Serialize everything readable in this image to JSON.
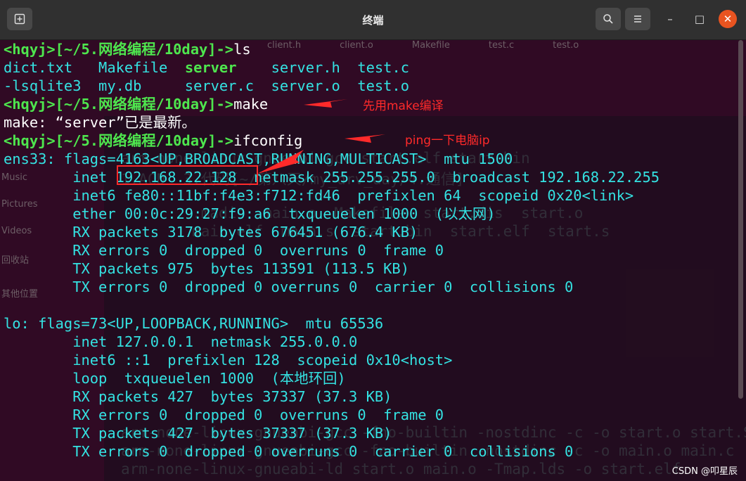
{
  "window": {
    "title": "终端",
    "new_tab_icon": "new-tab-icon",
    "search_icon": "search-icon",
    "menu_icon": "hamburger-menu-icon",
    "minimize": "–",
    "maximize": "□",
    "close": "✕"
  },
  "ghost": {
    "files": [
      "client.h",
      "client.o",
      "Makefile",
      "test.c",
      "test.o"
    ],
    "sidebar": [
      "Music",
      "Pictures",
      "Videos",
      "回收站",
      "其他位置"
    ]
  },
  "terminal": {
    "lines": [
      [
        {
          "t": "<hqyj>[~/5.网络编程/10day]->",
          "c": "g"
        },
        {
          "t": "ls",
          "c": "w"
        }
      ],
      [
        {
          "t": "dict.txt   Makefile  ",
          "c": "c"
        },
        {
          "t": "server",
          "c": "g"
        },
        {
          "t": "    server.h  test.c",
          "c": "c"
        }
      ],
      [
        {
          "t": "-lsqlite3  my.db     server.c  server.o  test.o",
          "c": "c"
        }
      ],
      [
        {
          "t": "<hqyj>[~/5.网络编程/10day]->",
          "c": "g"
        },
        {
          "t": "make",
          "c": "w"
        }
      ],
      [
        {
          "t": "make: “server”已是最新。",
          "c": "w"
        }
      ],
      [
        {
          "t": "<hqyj>[~/5.网络编程/10day]->",
          "c": "g"
        },
        {
          "t": "ifconfig",
          "c": "w"
        }
      ],
      [
        {
          "t": "ens33: flags=4163<UP,BROADCAST,RUNNING,MULTICAST>  mtu 1500",
          "c": "c"
        }
      ],
      [
        {
          "t": "        inet 192.168.22.128  netmask 255.255.255.0  broadcast 192.168.22.255",
          "c": "c"
        }
      ],
      [
        {
          "t": "        inet6 fe80::11bf:f4e3:f712:fd46  prefixlen 64  scopeid 0x20<link>",
          "c": "c"
        }
      ],
      [
        {
          "t": "        ether 00:0c:29:27:f9:a6  txqueuelen 1000  (以太网)",
          "c": "c"
        }
      ],
      [
        {
          "t": "        RX packets 3178  bytes 676451 (676.4 KB)",
          "c": "c"
        }
      ],
      [
        {
          "t": "        RX errors 0  dropped 0  overruns 0  frame 0",
          "c": "c"
        }
      ],
      [
        {
          "t": "        TX packets 975  bytes 113591 (113.5 KB)",
          "c": "c"
        }
      ],
      [
        {
          "t": "        TX errors 0  dropped 0 overruns 0  carrier 0  collisions 0",
          "c": "c"
        }
      ],
      [
        {
          "t": "",
          "c": "w"
        }
      ],
      [
        {
          "t": "lo: flags=73<UP,LOOPBACK,RUNNING>  mtu 65536",
          "c": "c"
        }
      ],
      [
        {
          "t": "        inet 127.0.0.1  netmask 255.0.0.0",
          "c": "c"
        }
      ],
      [
        {
          "t": "        inet6 ::1  prefixlen 128  scopeid 0x10<host>",
          "c": "c"
        }
      ],
      [
        {
          "t": "        loop  txqueuelen 1000  (本地环回)",
          "c": "c"
        }
      ],
      [
        {
          "t": "        RX packets 427  bytes 37337 (37.3 KB)",
          "c": "c"
        }
      ],
      [
        {
          "t": "        RX errors 0  dropped 0  overruns 0  frame 0",
          "c": "c"
        }
      ],
      [
        {
          "t": "        TX packets 427  bytes 37337 (37.3 KB)",
          "c": "c"
        }
      ],
      [
        {
          "t": "        TX errors 0  dropped 0 overruns 0  carrier 0  collisions 0",
          "c": "c"
        }
      ]
    ],
    "ghost_lines": [
      "arm-none-linux-gnueabi-gcc start.elf start.bin",
      "1.ACD  3.代码[~/第八天/my_drv_day/4.通信]",
      "        .madis  main.o  Makefile  start.dis  start.o",
      "        main.elf  main.s  start.bin  start.elf  start.s",
      "arm-none-linux-gnueabi-gcc -fno-builtin -nostdinc -c -o start.o start.S",
      "arm-none-linux-gnueabi-gcc -fno-builtin -nostdinc -c -o main.o main.c",
      "arm-none-linux-gnueabi-ld start.o main.o -Tmap.lds -o start.elf"
    ]
  },
  "annotations": {
    "make_note": "先用make编译",
    "ping_note": "ping一下电脑ip"
  },
  "watermark": "CSDN @叩星辰"
}
